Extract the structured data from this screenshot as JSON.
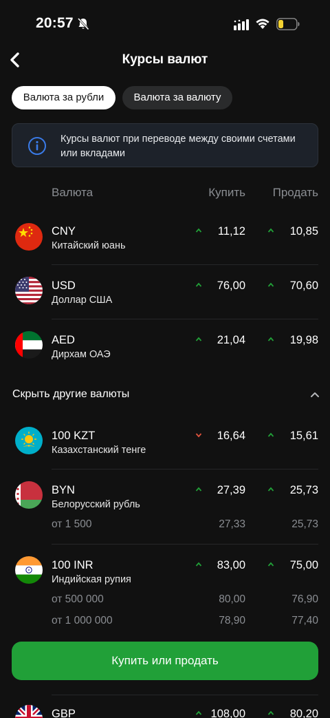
{
  "status_bar": {
    "time": "20:57"
  },
  "header": {
    "title": "Курсы валют",
    "back_icon": "chevron-left-icon"
  },
  "tabs": [
    {
      "label": "Валюта за рубли",
      "active": true
    },
    {
      "label": "Валюта за валюту",
      "active": false
    }
  ],
  "info": {
    "text": "Курсы валют при переводе между своими счетами или вкладами",
    "icon": "info-icon"
  },
  "columns": {
    "currency": "Валюта",
    "buy": "Купить",
    "sell": "Продать"
  },
  "rates": [
    {
      "code": "CNY",
      "name": "Китайский юань",
      "buy": "11,12",
      "buy_trend": "up",
      "sell": "10,85",
      "sell_trend": "up"
    },
    {
      "code": "USD",
      "name": "Доллар США",
      "buy": "76,00",
      "buy_trend": "up",
      "sell": "70,60",
      "sell_trend": "up"
    },
    {
      "code": "AED",
      "name": "Дирхам ОАЭ",
      "buy": "21,04",
      "buy_trend": "up",
      "sell": "19,98",
      "sell_trend": "up"
    }
  ],
  "toggle": {
    "label": "Скрыть другие валюты",
    "icon": "chevron-up-icon"
  },
  "other_rates": [
    {
      "code": "100 KZT",
      "name": "Казахстанский тенге",
      "buy": "16,64",
      "buy_trend": "down",
      "sell": "15,61",
      "sell_trend": "up",
      "tiers": []
    },
    {
      "code": "BYN",
      "name": "Белорусский рубль",
      "buy": "27,39",
      "buy_trend": "up",
      "sell": "25,73",
      "sell_trend": "up",
      "tiers": [
        {
          "label": "от 1 500",
          "buy": "27,33",
          "sell": "25,73"
        }
      ]
    },
    {
      "code": "100 INR",
      "name": "Индийская рупия",
      "buy": "83,00",
      "buy_trend": "up",
      "sell": "75,00",
      "sell_trend": "up",
      "tiers": [
        {
          "label": "от 500 000",
          "buy": "80,00",
          "sell": "76,90"
        },
        {
          "label": "от 1 000 000",
          "buy": "78,90",
          "sell": "77,40"
        }
      ]
    },
    {
      "code": "GBP",
      "buy": "108,00",
      "buy_trend": "up",
      "sell": "80,20",
      "sell_trend": "up",
      "tiers": []
    }
  ],
  "cta": {
    "label": "Купить или продать"
  },
  "colors": {
    "background": "#111111",
    "accent_green": "#21a038",
    "trend_up": "#21a038",
    "trend_down": "#e0533d",
    "muted_text": "#8b8e93"
  }
}
